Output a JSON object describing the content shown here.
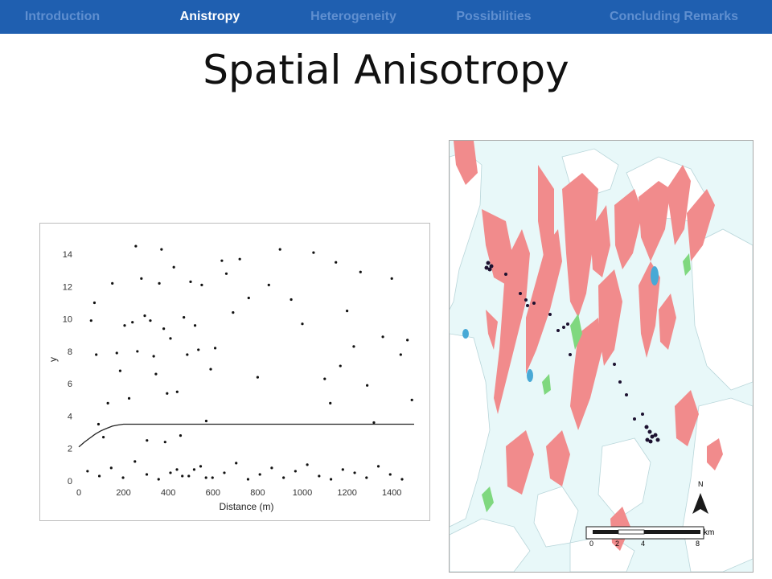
{
  "nav": {
    "items": [
      {
        "label": "Introduction",
        "active": false
      },
      {
        "label": "Anistropy",
        "active": true
      },
      {
        "label": "Heterogeneity",
        "active": false
      },
      {
        "label": "Possibilities",
        "active": false
      },
      {
        "label": "Concluding Remarks",
        "active": false
      }
    ],
    "colors": {
      "bar": "#1f5fb0",
      "active": "#ffffff",
      "inactive": "#5f8fd0"
    }
  },
  "slide": {
    "title": "Spatial Anisotropy"
  },
  "chart_data": {
    "type": "scatter",
    "xlabel": "Distance (m)",
    "ylabel": "y",
    "xlim": [
      0,
      1500
    ],
    "ylim": [
      0,
      15
    ],
    "xticks": [
      0,
      200,
      400,
      600,
      800,
      1000,
      1200,
      1400
    ],
    "yticks": [
      0,
      2,
      4,
      6,
      8,
      10,
      12,
      14
    ],
    "grid": false,
    "legend": "none",
    "fitted_line": {
      "x": [
        0,
        25,
        50,
        75,
        100,
        125,
        150,
        175,
        200,
        250,
        1500
      ],
      "y": [
        2.1,
        2.4,
        2.65,
        2.9,
        3.1,
        3.25,
        3.38,
        3.45,
        3.5,
        3.5,
        3.5
      ]
    },
    "points": {
      "x": [
        55,
        70,
        78,
        88,
        110,
        130,
        150,
        170,
        185,
        205,
        225,
        240,
        255,
        262,
        280,
        295,
        305,
        320,
        335,
        345,
        360,
        370,
        380,
        395,
        410,
        425,
        440,
        455,
        470,
        485,
        500,
        520,
        535,
        550,
        570,
        590,
        610,
        640,
        660,
        690,
        720,
        760,
        800,
        850,
        900,
        950,
        1000,
        1050,
        1100,
        1125,
        1150,
        1170,
        1200,
        1230,
        1260,
        1290,
        1320,
        1360,
        1400,
        1440,
        1470,
        1490
      ],
      "y": [
        9.9,
        11,
        7.8,
        3.5,
        2.7,
        4.8,
        12.2,
        7.9,
        6.8,
        9.6,
        5.1,
        9.8,
        14.5,
        8.0,
        12.5,
        10.2,
        2.5,
        9.9,
        7.7,
        6.6,
        12.2,
        14.3,
        9.4,
        5.4,
        8.8,
        13.2,
        5.5,
        2.8,
        10.1,
        7.8,
        12.3,
        9.6,
        8.1,
        12.1,
        3.7,
        6.9,
        8.2,
        13.6,
        12.8,
        10.4,
        13.7,
        11.3,
        6.4,
        12.1,
        14.3,
        11.2,
        9.7,
        14.1,
        6.3,
        4.8,
        13.5,
        7.1,
        10.5,
        8.3,
        12.9,
        5.9,
        3.6,
        8.9,
        12.5,
        7.8,
        8.7,
        5.0,
        2.4,
        0.7,
        0.3,
        0.9,
        0.2,
        0.5,
        1.1,
        0.1,
        0.4,
        0.8,
        0.2,
        0.6,
        1.0,
        0.3,
        0.1,
        0.7,
        0.5,
        0.2,
        0.9,
        0.4,
        0.1,
        0.6,
        0.3,
        0.8,
        0.2,
        1.2,
        0.4,
        0.1,
        0.5,
        0.3,
        0.7,
        0.2
      ]
    }
  },
  "map": {
    "scale_label": "km",
    "scale_ticks": [
      "0",
      "2",
      "4",
      "8"
    ],
    "north_label": "N",
    "colors": {
      "water": "#e8f8f9",
      "outcrop": "#f18b8c",
      "green": "#7fd87f",
      "lake": "#48a9d6",
      "points": "#1c1130"
    }
  }
}
